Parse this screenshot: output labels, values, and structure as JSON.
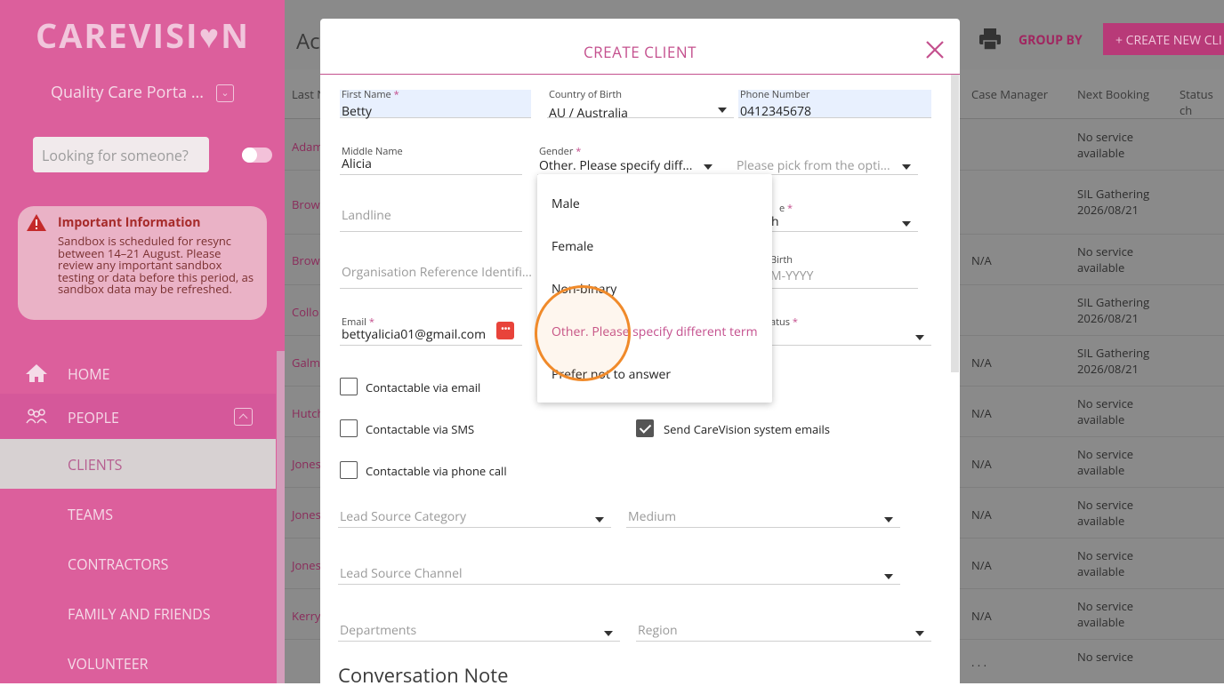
{
  "sidebar": {
    "logo": "CAREVISI♥N",
    "portal": "Quality Care Porta ...",
    "search_placeholder": "Looking for someone?",
    "info_title": "Important Information",
    "info_body": "Sandbox is scheduled for resync between 14–21 August. Please review any important sandbox testing or data before this period, as sandbox data may be refreshed.",
    "nav": {
      "home": "HOME",
      "people": "PEOPLE",
      "clients": "CLIENTS",
      "teams": "TEAMS",
      "contractors": "CONTRACTORS",
      "family": "FAMILY AND FRIENDS",
      "volunteer": "VOLUNTEER"
    }
  },
  "main": {
    "title": "Ac",
    "group_by": "GROUP BY",
    "create_new": "+ CREATE NEW CLI",
    "headers": {
      "last_name": "Last N",
      "case_manager": "Case Manager",
      "next_booking": "Next Booking",
      "status": "Status ch"
    },
    "rows": [
      {
        "name": "Adam",
        "case": "",
        "booking": "No service available"
      },
      {
        "name": "Brow",
        "case": "",
        "booking": "SIL Gathering 2026/08/21"
      },
      {
        "name": "Brow",
        "case": "N/A",
        "booking": "No service available"
      },
      {
        "name": "Collo",
        "case": "",
        "booking": "SIL Gathering 2026/08/21"
      },
      {
        "name": "Galm",
        "case": "N/A",
        "booking": "SIL Gathering 2026/08/21"
      },
      {
        "name": "Hutch",
        "case": "N/A",
        "booking": "No service available"
      },
      {
        "name": "Jones",
        "case": "N/A",
        "booking": "No service available"
      },
      {
        "name": "Jones",
        "case": "N/A",
        "booking": "No service available"
      },
      {
        "name": "Jones",
        "case": "N/A",
        "booking": "No service available"
      },
      {
        "name": "Kerry",
        "case": "N/A",
        "booking": "No service available"
      },
      {
        "name": "",
        "case": ". . .",
        "booking": "No service"
      }
    ]
  },
  "modal": {
    "title": "CREATE CLIENT",
    "first_name": {
      "label": "First Name",
      "value": "Betty"
    },
    "country": {
      "label": "Country of Birth",
      "value": "AU / Australia"
    },
    "phone": {
      "label": "Phone Number",
      "value": "0412345678"
    },
    "middle_name": {
      "label": "Middle Name",
      "value": "Alicia"
    },
    "gender": {
      "label": "Gender",
      "value": "Other. Please specify diff..."
    },
    "gender_other_placeholder": "Please pick from the opti...",
    "landline_placeholder": "Landline",
    "language_label_fragment": "e",
    "language_value_fragment": "h",
    "org_ref_placeholder": "Organisation Reference Identifi...",
    "dob_label_fragment": "Birth",
    "dob_placeholder_fragment": "M-YYYY",
    "email": {
      "label": "Email",
      "value": "bettyalicia01@gmail.com"
    },
    "status_label_fragment": "atus",
    "checks": {
      "email": "Contactable via email",
      "sms": "Contactable via SMS",
      "phone": "Contactable via phone call",
      "system_emails": "Send CareVision system emails"
    },
    "lead_source_category": "Lead Source Category",
    "medium": "Medium",
    "lead_source_channel": "Lead Source Channel",
    "departments": "Departments",
    "region": "Region",
    "conversation_note": "Conversation Note",
    "required_mark": "*",
    "email_dots": "•••"
  },
  "gender_options": [
    "Male",
    "Female",
    "Non-binary",
    "Other. Please specify different term",
    "Prefer not to answer"
  ],
  "colors": {
    "accent": "#c4508e",
    "sidebar": "#dc5f9c",
    "highlight": "#f08a2a"
  }
}
